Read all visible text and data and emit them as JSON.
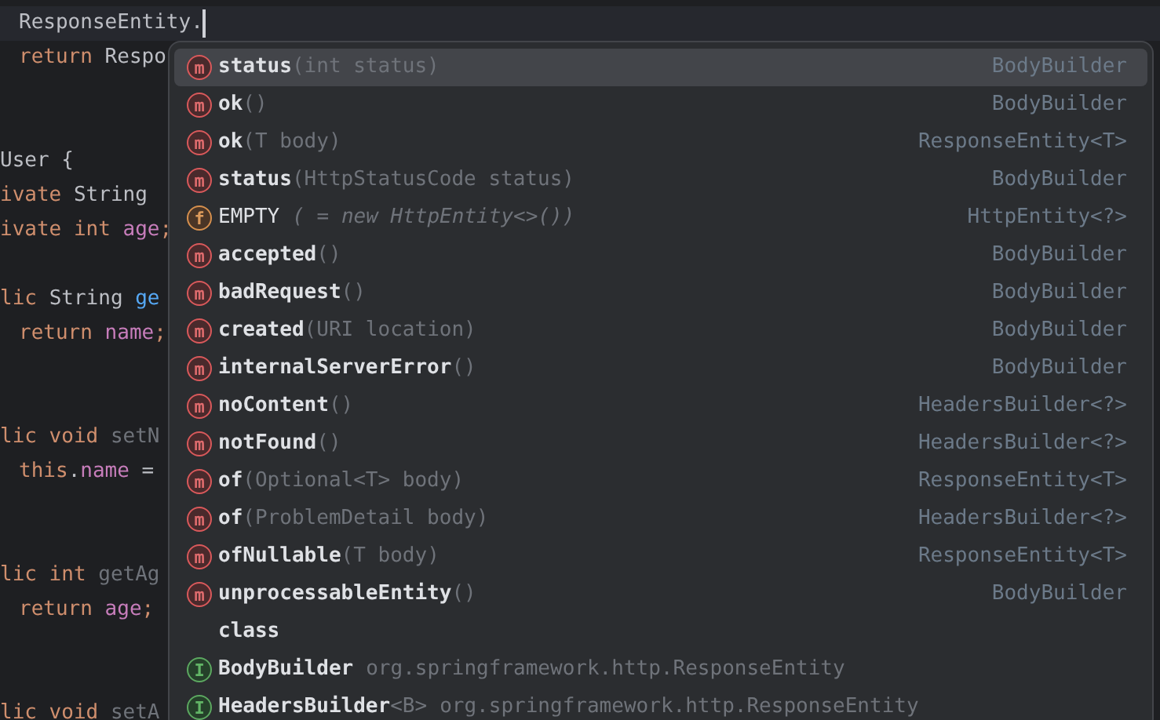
{
  "editor": {
    "lines": [
      {
        "kind": "code",
        "indented": true,
        "current": true,
        "caret": true,
        "tokens": [
          {
            "text": "ResponseEntity.",
            "kind": "plain"
          }
        ]
      },
      {
        "kind": "code",
        "indented": true,
        "tokens": [
          {
            "text": "return ",
            "kind": "keyword"
          },
          {
            "text": "Respo",
            "kind": "plain"
          }
        ]
      },
      {
        "kind": "blank"
      },
      {
        "kind": "blank"
      },
      {
        "kind": "code",
        "indented": false,
        "tokens": [
          {
            "text": "User {",
            "kind": "plain"
          }
        ]
      },
      {
        "kind": "code",
        "indented": false,
        "tokens": [
          {
            "text": "ivate ",
            "kind": "keyword"
          },
          {
            "text": "String",
            "kind": "plain"
          }
        ]
      },
      {
        "kind": "code",
        "indented": false,
        "tokens": [
          {
            "text": "ivate int ",
            "kind": "keyword"
          },
          {
            "text": "age",
            "kind": "field"
          },
          {
            "text": ";",
            "kind": "keyword"
          }
        ]
      },
      {
        "kind": "blank"
      },
      {
        "kind": "code",
        "indented": false,
        "tokens": [
          {
            "text": "lic ",
            "kind": "keyword"
          },
          {
            "text": "String ",
            "kind": "plain"
          },
          {
            "text": "ge",
            "kind": "method"
          }
        ]
      },
      {
        "kind": "code",
        "indented": true,
        "tokens": [
          {
            "text": "return ",
            "kind": "keyword"
          },
          {
            "text": "name",
            "kind": "field"
          },
          {
            "text": ";",
            "kind": "keyword"
          }
        ]
      },
      {
        "kind": "blank"
      },
      {
        "kind": "blank"
      },
      {
        "kind": "code",
        "indented": false,
        "tokens": [
          {
            "text": "lic void ",
            "kind": "keyword"
          },
          {
            "text": "setN",
            "kind": "unused"
          }
        ]
      },
      {
        "kind": "code",
        "indented": true,
        "tokens": [
          {
            "text": "this",
            "kind": "keyword"
          },
          {
            "text": ".",
            "kind": "plain"
          },
          {
            "text": "name",
            "kind": "field"
          },
          {
            "text": " =",
            "kind": "plain"
          }
        ]
      },
      {
        "kind": "blank"
      },
      {
        "kind": "blank"
      },
      {
        "kind": "code",
        "indented": false,
        "tokens": [
          {
            "text": "lic int ",
            "kind": "keyword"
          },
          {
            "text": "getAg",
            "kind": "unused"
          }
        ]
      },
      {
        "kind": "code",
        "indented": true,
        "tokens": [
          {
            "text": "return ",
            "kind": "keyword"
          },
          {
            "text": "age",
            "kind": "field"
          },
          {
            "text": ";",
            "kind": "keyword"
          }
        ]
      },
      {
        "kind": "blank"
      },
      {
        "kind": "blank"
      },
      {
        "kind": "code",
        "indented": false,
        "tokens": [
          {
            "text": "lic void ",
            "kind": "keyword"
          },
          {
            "text": "setA",
            "kind": "unused"
          }
        ]
      }
    ]
  },
  "completion_popup": {
    "items": [
      {
        "kind": "method",
        "icon": "m",
        "name": "status",
        "suffix": "(int status)",
        "type": "BodyBuilder",
        "selected": true
      },
      {
        "kind": "method",
        "icon": "m",
        "name": "ok",
        "suffix": "()",
        "type": "BodyBuilder",
        "selected": false
      },
      {
        "kind": "method",
        "icon": "m",
        "name": "ok",
        "suffix": "(T body)",
        "type": "ResponseEntity<T>",
        "selected": false
      },
      {
        "kind": "method",
        "icon": "m",
        "name": "status",
        "suffix": "(HttpStatusCode status)",
        "type": "BodyBuilder",
        "selected": false
      },
      {
        "kind": "field",
        "icon": "f",
        "name": "EMPTY",
        "suffix": "( = new HttpEntity<>())",
        "type": "HttpEntity<?>",
        "selected": false
      },
      {
        "kind": "method",
        "icon": "m",
        "name": "accepted",
        "suffix": "()",
        "type": "BodyBuilder",
        "selected": false
      },
      {
        "kind": "method",
        "icon": "m",
        "name": "badRequest",
        "suffix": "()",
        "type": "BodyBuilder",
        "selected": false
      },
      {
        "kind": "method",
        "icon": "m",
        "name": "created",
        "suffix": "(URI location)",
        "type": "BodyBuilder",
        "selected": false
      },
      {
        "kind": "method",
        "icon": "m",
        "name": "internalServerError",
        "suffix": "()",
        "type": "BodyBuilder",
        "selected": false
      },
      {
        "kind": "method",
        "icon": "m",
        "name": "noContent",
        "suffix": "()",
        "type": "HeadersBuilder<?>",
        "selected": false
      },
      {
        "kind": "method",
        "icon": "m",
        "name": "notFound",
        "suffix": "()",
        "type": "HeadersBuilder<?>",
        "selected": false
      },
      {
        "kind": "method",
        "icon": "m",
        "name": "of",
        "suffix": "(Optional<T> body)",
        "type": "ResponseEntity<T>",
        "selected": false
      },
      {
        "kind": "method",
        "icon": "m",
        "name": "of",
        "suffix": "(ProblemDetail body)",
        "type": "HeadersBuilder<?>",
        "selected": false
      },
      {
        "kind": "method",
        "icon": "m",
        "name": "ofNullable",
        "suffix": "(T body)",
        "type": "ResponseEntity<T>",
        "selected": false
      },
      {
        "kind": "method",
        "icon": "m",
        "name": "unprocessableEntity",
        "suffix": "()",
        "type": "BodyBuilder",
        "selected": false
      },
      {
        "kind": "keyword",
        "name": "class",
        "selected": false
      },
      {
        "kind": "interface",
        "icon": "I",
        "name": "BodyBuilder",
        "location": "org.springframework.http.ResponseEntity",
        "selected": false
      },
      {
        "kind": "interface",
        "icon": "I",
        "name": "HeadersBuilder",
        "suffix": "<B>",
        "location": "org.springframework.http.ResponseEntity",
        "selected": false
      }
    ]
  }
}
